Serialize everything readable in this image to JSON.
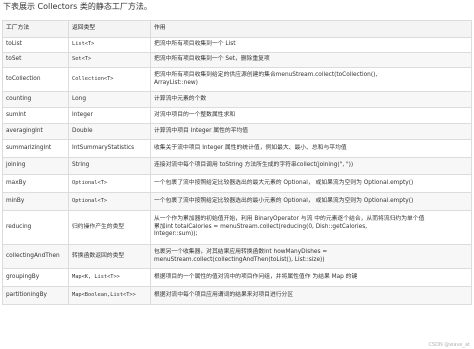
{
  "intro": "下表展示 Collectors 类的静态工厂方法。",
  "headers": [
    "工厂方法",
    "返回类型",
    "作用"
  ],
  "rows": [
    {
      "method": "toList",
      "type": "List<T>",
      "type_mono": true,
      "desc": [
        "把流中所有项目收集到一个 List"
      ]
    },
    {
      "method": "toSet",
      "type": "Set<T>",
      "type_mono": true,
      "desc": [
        "把流中所有项目收集到一个 Set，删除重复项"
      ]
    },
    {
      "method": "toCollection",
      "type": "Collection<T>",
      "type_mono": true,
      "desc": [
        "把流中所有项目收集到给定的供应源创建的集合menuStream.collect(toCollection(),",
        "ArrayList::new)"
      ]
    },
    {
      "method": "counting",
      "type": "Long",
      "type_mono": false,
      "desc": [
        "计算流中元素的个数"
      ]
    },
    {
      "method": "sumInt",
      "type": "Integer",
      "type_mono": false,
      "desc": [
        "对流中项目的一个整数属性求和"
      ]
    },
    {
      "method": "averagingInt",
      "type": "Double",
      "type_mono": false,
      "desc": [
        "计算流中项目 Integer 属性的平均值"
      ]
    },
    {
      "method": "summarizingInt",
      "type": "IntSummaryStatistics",
      "type_mono": false,
      "desc": [
        "收集关于流中项目 Integer 属性的统计值，例如最大、最小、总和与平均值"
      ]
    },
    {
      "method": "joining",
      "type": "String",
      "type_mono": false,
      "desc": [
        "连接对流中每个项目调用 toString 方法所生成的字符串collect(joining(\", \"))"
      ]
    },
    {
      "method": "maxBy",
      "type": "Optional<T>",
      "type_mono": true,
      "desc": [
        "一个包裹了流中按照给定比较器选出的最大元素的 Optional， 或如果流为空则为 Optional.empty()"
      ]
    },
    {
      "method": "minBy",
      "type": "Optional<T>",
      "type_mono": true,
      "desc": [
        "一个包裹了流中按照给定比较器选出的最小元素的 Optional， 或如果流为空则为 Optional.empty()"
      ]
    },
    {
      "method": "reducing",
      "type": "归约操作产生的类型",
      "type_mono": false,
      "desc": [
        "从一个作为累加器的初始值开始，利用 BinaryOperator 与流 中的元素逐个结合，从而将流归约为单个值",
        "累加int totalCalories = menuStream.collect(reducing(0, Dish::getCalories,",
        "Integer::sum));"
      ]
    },
    {
      "method": "collectingAndThen",
      "type": "转换函数返回的类型",
      "type_mono": false,
      "desc": [
        "包裹另一个收集器，对其结果应用转换函数int howManyDishes =",
        "menuStream.collect(collectingAndThen(toList(), List::size))"
      ]
    },
    {
      "method": "groupingBy",
      "type": "Map<K, List<T>>",
      "type_mono": true,
      "desc": [
        "根据项目的一个属性的值对流中的项目作问组，并将属性值作 为结果 Map 的键"
      ]
    },
    {
      "method": "partitioningBy",
      "type": "Map<Boolean,List<T>>",
      "type_mono": true,
      "desc": [
        "根据对流中每个项目应用谓词的结果来对项目进行分区"
      ]
    }
  ],
  "watermark": "CSDN @wave_at"
}
